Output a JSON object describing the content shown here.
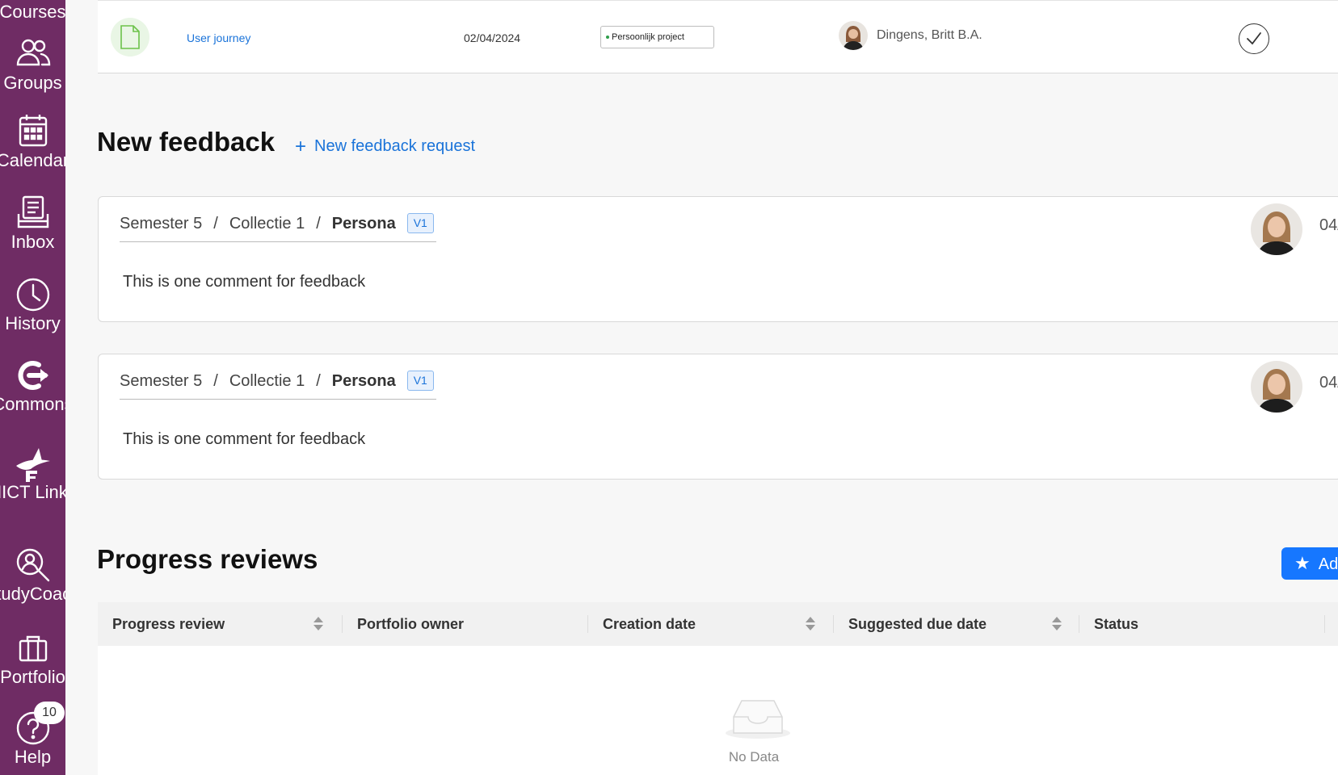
{
  "sidebar": {
    "items": [
      {
        "label": "Courses",
        "icon": "courses-icon"
      },
      {
        "label": "Groups",
        "icon": "groups-icon"
      },
      {
        "label": "Calendar",
        "icon": "calendar-icon"
      },
      {
        "label": "Inbox",
        "icon": "inbox-icon"
      },
      {
        "label": "History",
        "icon": "history-icon"
      },
      {
        "label": "Commons",
        "icon": "commons-icon"
      },
      {
        "label": "HICT Links",
        "icon": "hict-links-icon"
      },
      {
        "label": "StudyCoach",
        "icon": "studycoach-icon"
      },
      {
        "label": "Portfolio",
        "icon": "portfolio-icon"
      },
      {
        "label": "Help",
        "icon": "help-icon",
        "badge": "10"
      }
    ],
    "background": "#6f2c64"
  },
  "file_row": {
    "name": "User journey",
    "date": "02/04/2024",
    "tag": "Persoonlijk project",
    "owner": "Dingens, Britt B.A."
  },
  "feedback": {
    "title": "New feedback",
    "new_request": "New feedback request",
    "cards": [
      {
        "crumb1": "Semester 5",
        "crumb2": "Collectie 1",
        "crumb3": "Persona",
        "version": "V1",
        "comment": "This is one comment for feedback",
        "date": "04/"
      },
      {
        "crumb1": "Semester 5",
        "crumb2": "Collectie 1",
        "crumb3": "Persona",
        "version": "V1",
        "comment": "This is one comment for feedback",
        "date": "04/"
      }
    ]
  },
  "progress": {
    "title": "Progress reviews",
    "add_button": "Ad",
    "columns": [
      "Progress review",
      "Portfolio owner",
      "Creation date",
      "Suggested due date",
      "Status"
    ],
    "empty": "No Data"
  },
  "colors": {
    "accent": "#1677ff",
    "link": "#1a73d9"
  }
}
